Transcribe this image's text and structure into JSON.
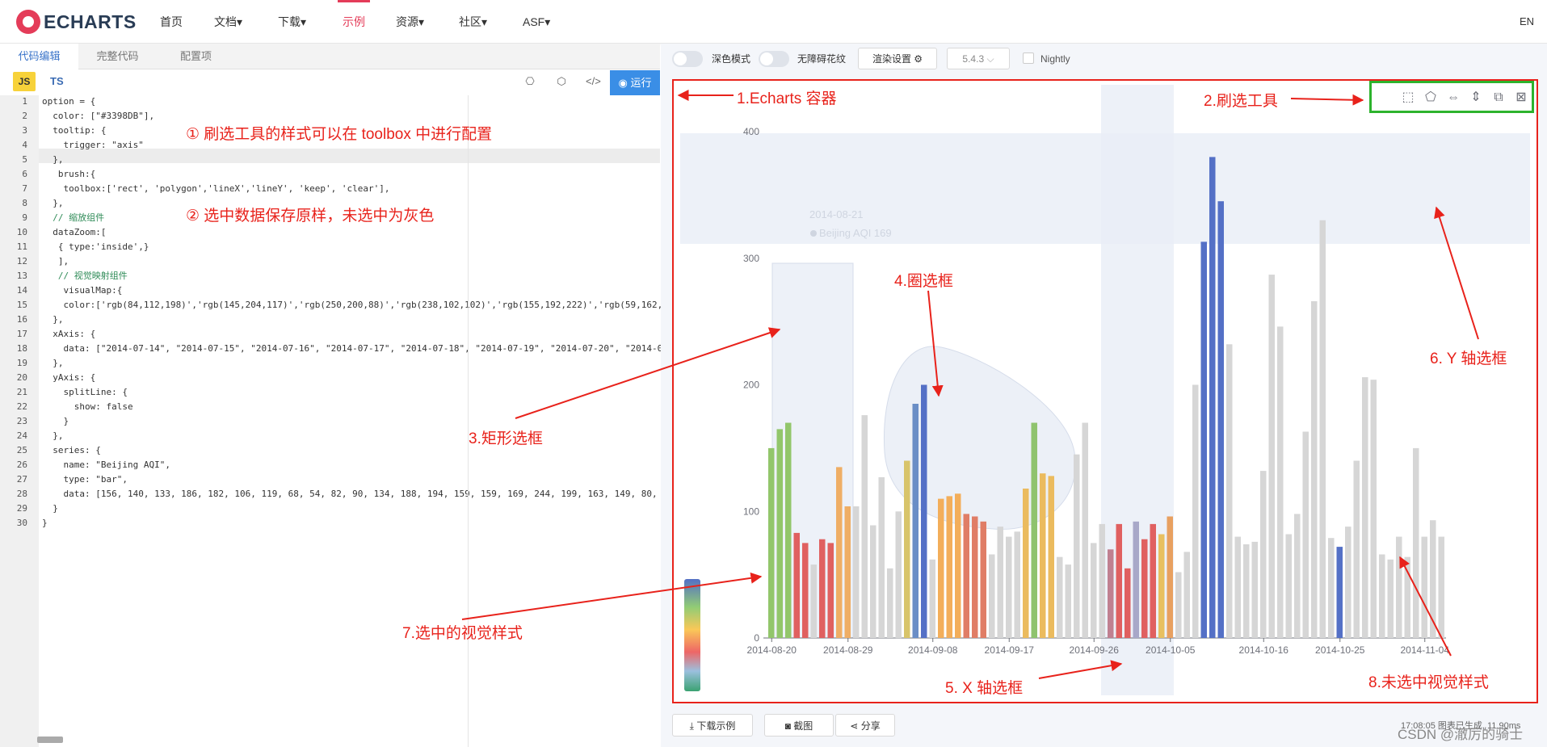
{
  "nav": {
    "logo_text": "ECHARTS",
    "items": [
      {
        "label": "首页"
      },
      {
        "label": "文档▾"
      },
      {
        "label": "下载▾"
      },
      {
        "label": "示例"
      },
      {
        "label": "资源▾"
      },
      {
        "label": "社区▾"
      },
      {
        "label": "ASF▾"
      }
    ],
    "lang": "EN",
    "accent_color": "#e43c59"
  },
  "editor": {
    "tabs": [
      {
        "label": "代码编辑"
      },
      {
        "label": "完整代码"
      },
      {
        "label": "配置项"
      }
    ],
    "lang_js": "JS",
    "lang_ts": "TS",
    "run_label": "运行",
    "lines": [
      {
        "n": "1",
        "text": "option = {"
      },
      {
        "n": "2",
        "text": "  color: [\"#3398DB\"],"
      },
      {
        "n": "3",
        "text": "  tooltip: {"
      },
      {
        "n": "4",
        "text": "    trigger: \"axis\""
      },
      {
        "n": "5",
        "text": "  },"
      },
      {
        "n": "6",
        "text": "   brush:{"
      },
      {
        "n": "7",
        "text": "    toolbox:['rect', 'polygon','lineX','lineY', 'keep', 'clear'],"
      },
      {
        "n": "8",
        "text": "  },"
      },
      {
        "n": "9",
        "text": "  // 缩放组件"
      },
      {
        "n": "10",
        "text": "  dataZoom:["
      },
      {
        "n": "11",
        "text": "   { type:'inside',}"
      },
      {
        "n": "12",
        "text": "   ],"
      },
      {
        "n": "13",
        "text": "   // 视觉映射组件"
      },
      {
        "n": "14",
        "text": "    visualMap:{"
      },
      {
        "n": "15",
        "text": "    color:['rgb(84,112,198)','rgb(145,204,117)','rgb(250,200,88)','rgb(238,102,102)','rgb(155,192,222)','rgb(59,162,"
      },
      {
        "n": "16",
        "text": "  },"
      },
      {
        "n": "17",
        "text": "  xAxis: {"
      },
      {
        "n": "18",
        "text": "    data: [\"2014-07-14\", \"2014-07-15\", \"2014-07-16\", \"2014-07-17\", \"2014-07-18\", \"2014-07-19\", \"2014-07-20\", \"2014-0"
      },
      {
        "n": "19",
        "text": "  },"
      },
      {
        "n": "20",
        "text": "  yAxis: {"
      },
      {
        "n": "21",
        "text": "    splitLine: {"
      },
      {
        "n": "22",
        "text": "      show: false"
      },
      {
        "n": "23",
        "text": "    }"
      },
      {
        "n": "24",
        "text": "  },"
      },
      {
        "n": "25",
        "text": "  series: {"
      },
      {
        "n": "26",
        "text": "    name: \"Beijing AQI\","
      },
      {
        "n": "27",
        "text": "    type: \"bar\","
      },
      {
        "n": "28",
        "text": "    data: [156, 140, 133, 186, 182, 106, 119, 68, 54, 82, 90, 134, 188, 194, 159, 159, 169, 244, 199, 163, 149, 80,"
      },
      {
        "n": "29",
        "text": "  }"
      },
      {
        "n": "30",
        "text": "}"
      }
    ]
  },
  "annotations": {
    "a1": "① 刷选工具的样式可以在 toolbox 中进行配置",
    "a2": "② 选中数据保存原样，未选中为灰色",
    "container": "1.Echarts 容器",
    "brush_tool": "2.刷选工具",
    "rect_select": "3.矩形选框",
    "lasso_select": "4.圈选框",
    "x_select": "5. X 轴选框",
    "y_select": "6. Y 轴选框",
    "selected_style": "7.选中的视觉样式",
    "unselected_style": "8.未选中视觉样式"
  },
  "preview": {
    "dark_mode_label": "深色模式",
    "a11y_label": "无障碍花纹",
    "render_btn": "渲染设置 ⚙",
    "version": "5.4.3",
    "nightly_label": "Nightly",
    "download_btn": "下载示例",
    "screenshot_btn": "截图",
    "share_btn": "分享",
    "status_text": "17:08:05   图表已生成, 11.90ms",
    "watermark": "CSDN @澈厉的骑士",
    "tooltip_date": "2014-08-21",
    "tooltip_series": "Beijing AQI",
    "tooltip_value": "169",
    "annotation_color": "#e8221b",
    "brush_box_color": "#2db32d"
  },
  "chart_data": {
    "type": "bar",
    "series": [
      {
        "name": "Beijing AQI"
      }
    ],
    "y_ticks": [
      "0",
      "100",
      "200",
      "300",
      "400"
    ],
    "ylim": [
      0,
      400
    ],
    "x_ticks": [
      "2014-08-20",
      "2014-08-29",
      "2014-09-08",
      "2014-09-17",
      "2014-09-26",
      "2014-10-05",
      "2014-10-16",
      "2014-10-25",
      "2014-11-04"
    ],
    "values": [
      150,
      165,
      170,
      83,
      75,
      58,
      78,
      75,
      135,
      104,
      104,
      176,
      89,
      127,
      55,
      100,
      140,
      185,
      200,
      62,
      110,
      112,
      114,
      98,
      96,
      92,
      66,
      88,
      80,
      84,
      118,
      170,
      130,
      128,
      64,
      58,
      145,
      170,
      75,
      90,
      70,
      90,
      55,
      92,
      78,
      90,
      82,
      96,
      52,
      68,
      200,
      313,
      380,
      345,
      232,
      80,
      74,
      76,
      132,
      287,
      246,
      82,
      98,
      163,
      266,
      330,
      79,
      72,
      88,
      140,
      206,
      204,
      66,
      62,
      80,
      64,
      150,
      80,
      93,
      80
    ],
    "colors": [
      "#92c66b",
      "#92c66b",
      "#92c66b",
      "#e06060",
      "#e06060",
      "#d6d6d6",
      "#e06060",
      "#e06060",
      "#efae65",
      "#efae65",
      "#d6d6d6",
      "#d6d6d6",
      "#d6d6d6",
      "#d6d6d6",
      "#d6d6d6",
      "#d6d6d6",
      "#d8c46a",
      "#6a8ec6",
      "#5470c6",
      "#d6d6d6",
      "#f3ae5a",
      "#f3ae5a",
      "#f3ae5a",
      "#e07d66",
      "#e07d66",
      "#e07d66",
      "#d6d6d6",
      "#d6d6d6",
      "#d6d6d6",
      "#d6d6d6",
      "#ebbb5e",
      "#8fc36e",
      "#ebbb5e",
      "#ebbb5e",
      "#d6d6d6",
      "#d6d6d6",
      "#d6d6d6",
      "#d6d6d6",
      "#d6d6d6",
      "#d6d6d6",
      "#c08090",
      "#e06060",
      "#e06060",
      "#a8a8c8",
      "#e06060",
      "#e06060",
      "#e8c060",
      "#e8a060",
      "#d6d6d6",
      "#d6d6d6",
      "#d6d6d6",
      "#5470c6",
      "#5470c6",
      "#5470c6",
      "#d6d6d6",
      "#d6d6d6",
      "#d6d6d6",
      "#d6d6d6",
      "#d6d6d6",
      "#d6d6d6",
      "#d6d6d6",
      "#d6d6d6",
      "#d6d6d6",
      "#d6d6d6",
      "#d6d6d6",
      "#d6d6d6",
      "#d6d6d6",
      "#5470c6",
      "#d6d6d6",
      "#d6d6d6",
      "#d6d6d6",
      "#d6d6d6",
      "#d6d6d6",
      "#d6d6d6",
      "#d6d6d6",
      "#d6d6d6",
      "#d6d6d6",
      "#d6d6d6",
      "#d6d6d6",
      "#d6d6d6"
    ],
    "brush_rect_x_range": [
      "2014-08-20",
      "2014-08-29"
    ],
    "brush_rect_y_range": [
      0,
      300
    ],
    "brush_y_range": [
      320,
      400
    ],
    "brush_x_range": [
      "2014-09-30",
      "2014-10-07"
    ]
  }
}
